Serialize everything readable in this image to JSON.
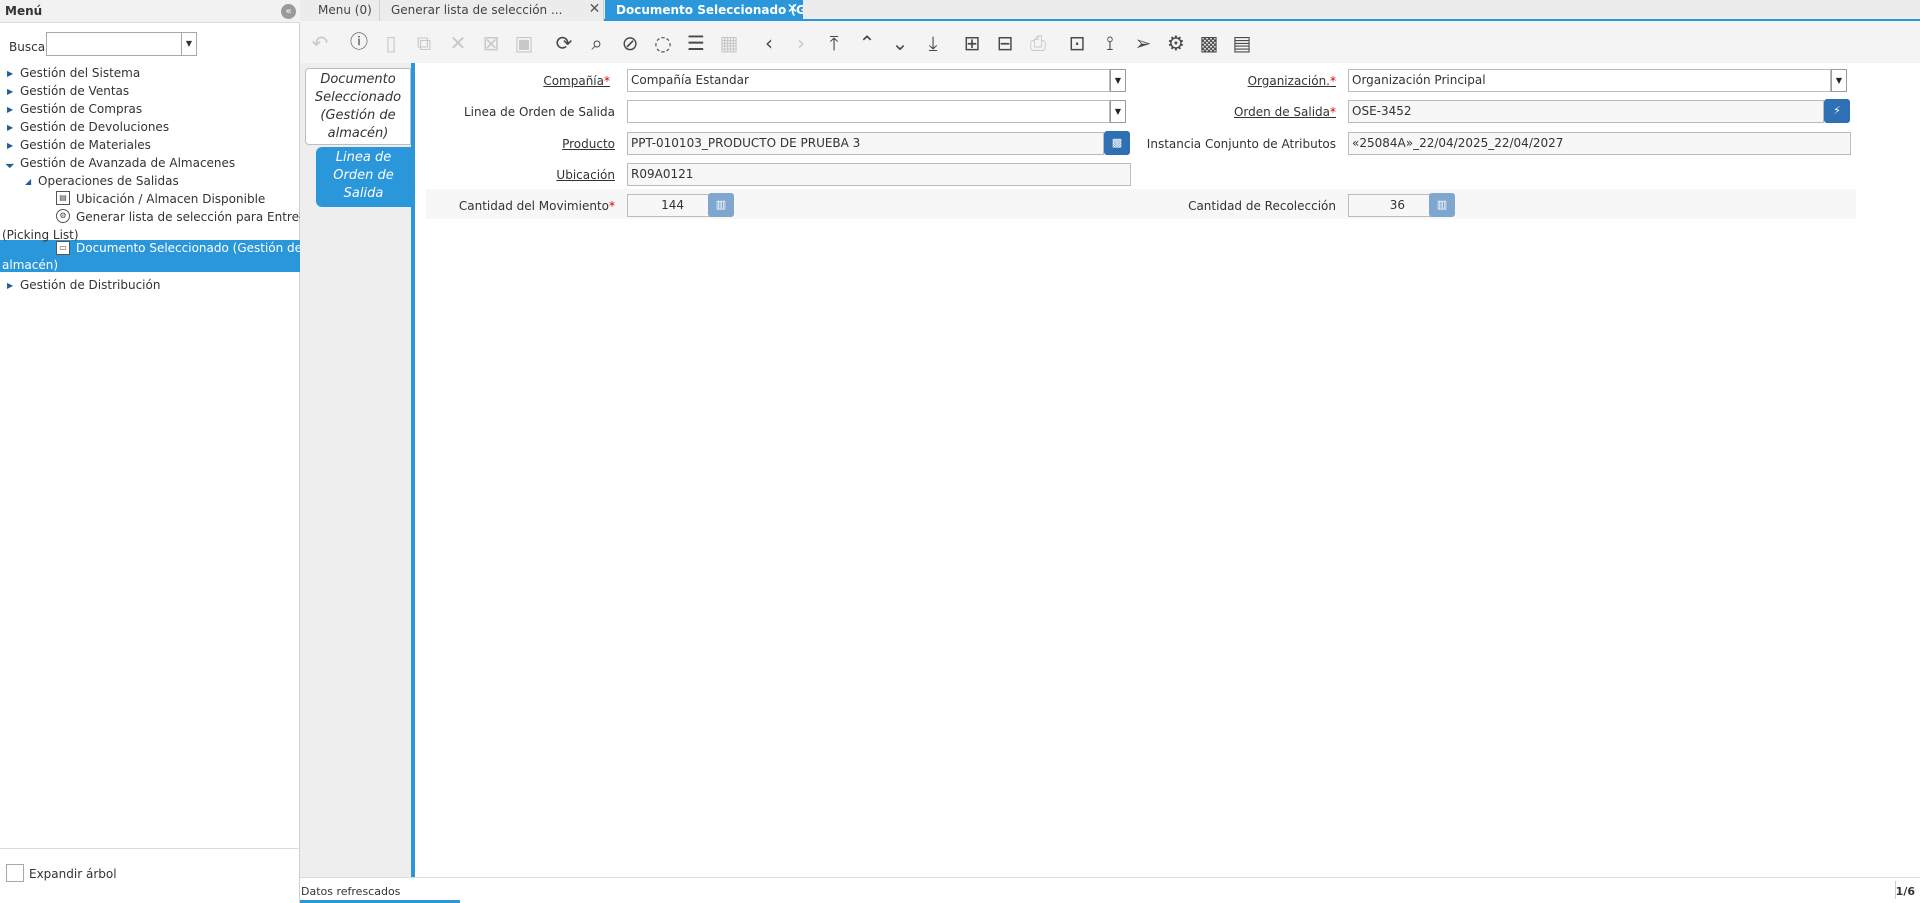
{
  "menu": {
    "title": "Menú",
    "collapse_icon": "«",
    "search_label": "Buscar:",
    "search_value": "",
    "expand_tree_label": "Expandir árbol",
    "tree": [
      {
        "label": "Gestión del Sistema",
        "expanded": false
      },
      {
        "label": "Gestión de Ventas",
        "expanded": false
      },
      {
        "label": "Gestión de Compras",
        "expanded": false
      },
      {
        "label": "Gestión de Devoluciones",
        "expanded": false
      },
      {
        "label": "Gestión de Materiales",
        "expanded": false
      },
      {
        "label": "Gestión de Avanzada de Almacenes",
        "expanded": true
      },
      {
        "label": "Operaciones de Salidas",
        "expanded": true
      },
      {
        "label": "Ubicación / Almacen Disponible",
        "icon": "report-icon"
      },
      {
        "label": "Generar lista de selección para Entrega (Picking List)",
        "label_line1": "Generar lista de selección para Entrega",
        "label_line2": "(Picking List)",
        "icon": "process-icon"
      },
      {
        "label": "Documento Seleccionado (Gestión de almacén)",
        "label_line1": "Documento Seleccionado (Gestión de",
        "label_line2": "almacén)",
        "icon": "window-icon",
        "selected": true
      },
      {
        "label": "Gestión de Distribución",
        "expanded": false
      }
    ]
  },
  "tabs": [
    {
      "label": "Menu (0)",
      "active": false
    },
    {
      "label": "Generar lista de selección ...",
      "active": false
    },
    {
      "label": "Documento Seleccionado (Ges...",
      "active": true
    }
  ],
  "toolbar": {
    "icons": [
      "undo-icon",
      "help-icon",
      "new-icon",
      "copy-icon",
      "delete-icon",
      "delete-selection-icon",
      "save-icon",
      "refresh-icon",
      "find-icon",
      "attachment-icon",
      "chat-icon",
      "grid-toggle-icon",
      "calendar-icon",
      "previous-icon",
      "next-icon",
      "first-icon",
      "parent-icon",
      "detail-icon",
      "last-icon",
      "report-icon",
      "archive-icon",
      "print-icon",
      "zoom-across-icon",
      "workflow-icon",
      "send-icon",
      "process-icon",
      "product-info-icon",
      "export-icon"
    ]
  },
  "detail_tabs": [
    {
      "label_lines": [
        "Documento",
        "Seleccionado",
        "(Gestión de",
        "almacén)"
      ],
      "active": false
    },
    {
      "label_lines": [
        "Linea de",
        "Orden de",
        "Salida"
      ],
      "active": true
    }
  ],
  "form": {
    "company": {
      "label": "Compañía",
      "required": true,
      "value": "Compañía Estandar"
    },
    "organization": {
      "label": "Organización.",
      "required": true,
      "value": "Organización Principal"
    },
    "order_line": {
      "label": "Linea de Orden de Salida",
      "value": ""
    },
    "output_order": {
      "label": "Orden de Salida",
      "required": true,
      "value": "OSE-3452"
    },
    "product": {
      "label": "Producto",
      "value": "PPT-010103_PRODUCTO DE PRUEBA 3"
    },
    "attr_instance": {
      "label": "Instancia Conjunto de Atributos",
      "value": "«25084A»_22/04/2025_22/04/2027"
    },
    "locator": {
      "label": "Ubicación",
      "value": "R09A0121"
    },
    "movement_qty": {
      "label": "Cantidad del Movimiento",
      "required": true,
      "value": "144"
    },
    "picked_qty": {
      "label": "Cantidad de Recolección",
      "value": "36"
    }
  },
  "status": {
    "message": "Datos refrescados",
    "page": "1/6"
  },
  "colors": {
    "accent": "#2a97db",
    "required": "#d40000",
    "button": "#2f6fb4"
  }
}
